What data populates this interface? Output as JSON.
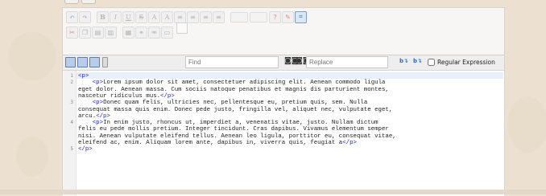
{
  "top_buttons": [
    "",
    ""
  ],
  "toolbar": {
    "row1": [
      {
        "icon": "undo-icon",
        "glyph": "↶"
      },
      {
        "icon": "redo-icon",
        "glyph": "↷"
      },
      {
        "icon": "bold-icon",
        "glyph": "B"
      },
      {
        "icon": "italic-icon",
        "glyph": "I"
      },
      {
        "icon": "underline-icon",
        "glyph": "U"
      },
      {
        "icon": "strikethrough-icon",
        "glyph": "S"
      },
      {
        "icon": "superscript-icon",
        "glyph": "A"
      },
      {
        "icon": "subscript-icon",
        "glyph": "A"
      },
      {
        "icon": "align-left-icon",
        "glyph": "≡"
      },
      {
        "icon": "align-center-icon",
        "glyph": "≡"
      },
      {
        "icon": "align-right-icon",
        "glyph": "≡"
      },
      {
        "icon": "justify-icon",
        "glyph": "≡"
      }
    ],
    "row2": [
      {
        "icon": "cut-icon",
        "glyph": "✂"
      },
      {
        "icon": "copy-icon",
        "glyph": "❐"
      },
      {
        "icon": "paste-icon",
        "glyph": "▤"
      },
      {
        "icon": "paste-text-icon",
        "glyph": "▥"
      },
      {
        "icon": "table-icon",
        "glyph": "▦"
      },
      {
        "icon": "link-icon",
        "glyph": "⚭"
      },
      {
        "icon": "unlink-icon",
        "glyph": "⚮"
      },
      {
        "icon": "image-icon",
        "glyph": "▭"
      }
    ]
  },
  "editarea": {
    "find_placeholder": "Find",
    "replace_placeholder": "Replace",
    "regex_label": "Regular Expression",
    "line_numbers": [
      "1",
      "2",
      "3",
      "4",
      "5"
    ]
  },
  "code_lines": [
    {
      "segments": [
        {
          "t": "<p>",
          "tag": true
        }
      ]
    },
    {
      "segments": [
        {
          "t": "    ",
          "tag": false
        },
        {
          "t": "<p>",
          "tag": true
        },
        {
          "t": "Lorem ipsum dolor sit amet, consectetuer adipiscing elit. Aenean commodo ligula",
          "tag": false
        }
      ]
    },
    {
      "segments": [
        {
          "t": "eget dolor. Aenean massa. Cum sociis natoque penatibus et magnis dis parturient montes,",
          "tag": false
        }
      ]
    },
    {
      "segments": [
        {
          "t": "nascetur ridiculus mus.",
          "tag": false
        },
        {
          "t": "</p>",
          "tag": true
        }
      ]
    },
    {
      "segments": [
        {
          "t": "    ",
          "tag": false
        },
        {
          "t": "<p>",
          "tag": true
        },
        {
          "t": "Donec quam felis, ultricies nec, pellentesque eu, pretium quis, sem. Nulla",
          "tag": false
        }
      ]
    },
    {
      "segments": [
        {
          "t": "consequat massa quis enim. Donec pede justo, fringilla vel, aliquet nec, vulputate eget,",
          "tag": false
        }
      ]
    },
    {
      "segments": [
        {
          "t": "arcu.",
          "tag": false
        },
        {
          "t": "</p>",
          "tag": true
        }
      ]
    },
    {
      "segments": [
        {
          "t": "    ",
          "tag": false
        },
        {
          "t": "<p>",
          "tag": true
        },
        {
          "t": "In enim justo, rhoncus ut, imperdiet a, venenatis vitae, justo. Nullam dictum",
          "tag": false
        }
      ]
    },
    {
      "segments": [
        {
          "t": "felis eu pede mollis pretium. Integer tincidunt. Cras dapibus. Vivamus elementum semper",
          "tag": false
        }
      ]
    },
    {
      "segments": [
        {
          "t": "nisi. Aenean vulputate eleifend tellus. Aenean leo ligula, porttitor eu, consequat vitae,",
          "tag": false
        }
      ]
    },
    {
      "segments": [
        {
          "t": "eleifend ac, enim. Aliquam lorem ante, dapibus in, viverra quis, feugiat a",
          "tag": false
        },
        {
          "t": "</p>",
          "tag": true
        }
      ]
    },
    {
      "segments": [
        {
          "t": "</p>",
          "tag": true
        }
      ]
    }
  ]
}
